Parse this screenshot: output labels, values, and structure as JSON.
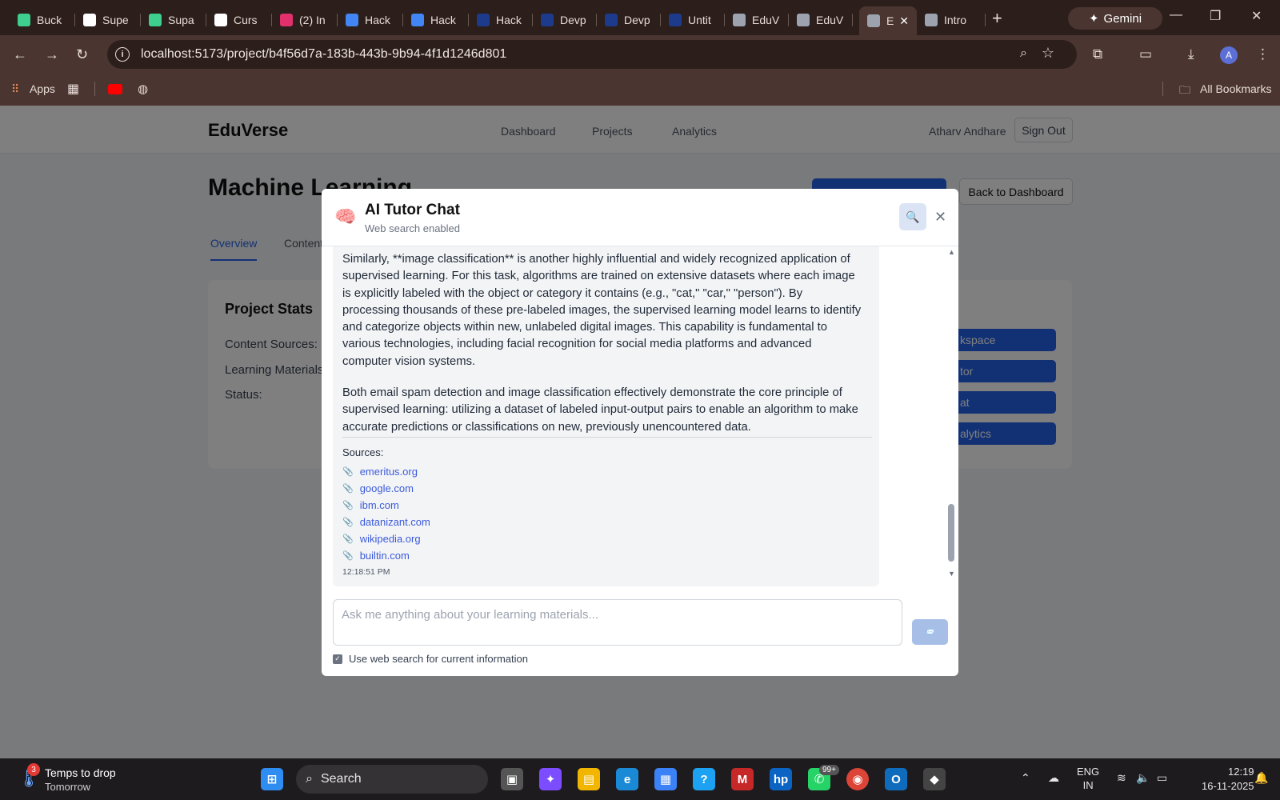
{
  "browser": {
    "tabs": [
      {
        "label": "Buck",
        "icon": "bolt-icon",
        "color": "#3ecf8e"
      },
      {
        "label": "Supe",
        "icon": "openai-icon",
        "color": "#ffffff"
      },
      {
        "label": "Supa",
        "icon": "bolt-icon",
        "color": "#3ecf8e"
      },
      {
        "label": "Curs",
        "icon": "cube-icon",
        "color": "#ffffff"
      },
      {
        "label": "(2) In",
        "icon": "instagram-icon",
        "color": "#e1306c"
      },
      {
        "label": "Hack",
        "icon": "docs-icon",
        "color": "#4285f4"
      },
      {
        "label": "Hack",
        "icon": "docs-icon",
        "color": "#4285f4"
      },
      {
        "label": "Hack",
        "icon": "d-icon",
        "color": "#1e3a8a"
      },
      {
        "label": "Devp",
        "icon": "d-icon",
        "color": "#1e3a8a"
      },
      {
        "label": "Devp",
        "icon": "d-icon",
        "color": "#1e3a8a"
      },
      {
        "label": "Untit",
        "icon": "d-icon",
        "color": "#1e3a8a"
      },
      {
        "label": "EduV",
        "icon": "globe-icon",
        "color": "#9ca3af"
      },
      {
        "label": "EduV",
        "icon": "globe-icon",
        "color": "#9ca3af"
      },
      {
        "label": "E",
        "icon": "globe-icon",
        "color": "#9ca3af",
        "active": true
      },
      {
        "label": "Intro",
        "icon": "globe-icon",
        "color": "#9ca3af"
      }
    ],
    "gemini_label": "Gemini",
    "url": "localhost:5173/project/b4f56d7a-183b-443b-9b94-4f1d1246d801",
    "bookmarks": {
      "apps": "Apps",
      "all": "All Bookmarks"
    },
    "profile_initial": "A"
  },
  "app": {
    "logo": "EduVerse",
    "nav": [
      "Dashboard",
      "Projects",
      "Analytics"
    ],
    "user": "Atharv Andhare",
    "sign_out": "Sign Out",
    "project_title": "Machine Learning",
    "back_button": "Back to Dashboard",
    "tabs": [
      "Overview",
      "Content"
    ],
    "stats_title": "Project Stats",
    "stats": [
      "Content Sources:",
      "Learning Materials",
      "Status:"
    ],
    "quick_actions": [
      "kspace",
      "tor",
      "at",
      "alytics"
    ]
  },
  "modal": {
    "title": "AI Tutor Chat",
    "subtitle": "Web search enabled",
    "message": {
      "para1": "Similarly, **image classification** is another highly influential and widely recognized application of supervised learning. For this task, algorithms are trained on extensive datasets where each image is explicitly labeled with the object or category it contains (e.g., \"cat,\" \"car,\" \"person\"). By processing thousands of these pre-labeled images, the supervised learning model learns to identify and categorize objects within new, unlabeled digital images. This capability is fundamental to various technologies, including facial recognition for social media platforms and advanced computer vision systems.",
      "para2": "Both email spam detection and image classification effectively demonstrate the core principle of supervised learning: utilizing a dataset of labeled input-output pairs to enable an algorithm to make accurate predictions or classifications on new, previously unencountered data.",
      "sources_label": "Sources:",
      "sources": [
        "emeritus.org",
        "google.com",
        "ibm.com",
        "datanizant.com",
        "wikipedia.org",
        "builtin.com"
      ],
      "time": "12:18:51 PM"
    },
    "input_placeholder": "Ask me anything about your learning materials...",
    "web_search_label": "Use web search for current information"
  },
  "taskbar": {
    "weather_title": "Temps to drop",
    "weather_sub": "Tomorrow",
    "weather_badge": "3",
    "search": "Search",
    "whatsapp_badge": "99+",
    "lang1": "ENG",
    "lang2": "IN",
    "time": "12:19",
    "date": "16-11-2025"
  }
}
